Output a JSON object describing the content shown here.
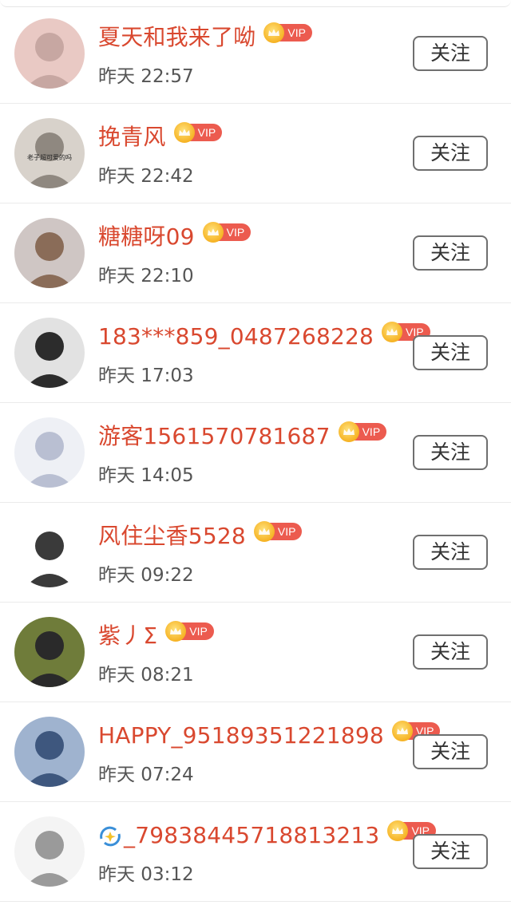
{
  "colors": {
    "name": "#d9482f",
    "vip_badge": "#ec5b4f",
    "crown": "#f6b324",
    "time": "#555555",
    "divider": "#ebebeb"
  },
  "vip_label": "VIP",
  "follow_label": "关注",
  "rows": [
    {
      "name": "夏天和我来了呦",
      "time": "昨天 22:57",
      "avatar": "avatar-girl-pink-hair",
      "avatar_colors": [
        "#e9c9c4",
        "#c7a7a2"
      ]
    },
    {
      "name": "挽青风",
      "time": "昨天 22:42",
      "avatar": "avatar-cat",
      "avatar_colors": [
        "#d8d2cb",
        "#8f8880"
      ],
      "avatar_caption": "老子超可爱的吗"
    },
    {
      "name": "糖糖呀09",
      "time": "昨天 22:10",
      "avatar": "avatar-teddy-bear",
      "avatar_colors": [
        "#cfc6c4",
        "#8a6c58"
      ]
    },
    {
      "name": "183***859_0487268228",
      "time": "昨天 17:03",
      "avatar": "avatar-boy-silver-hair",
      "avatar_colors": [
        "#e2e2e2",
        "#2c2c2c"
      ]
    },
    {
      "name": "游客1561570781687",
      "time": "昨天 14:05",
      "avatar": "avatar-anime-girl-flowers",
      "avatar_colors": [
        "#eef0f5",
        "#b9bfd2"
      ]
    },
    {
      "name": "风住尘香5528",
      "time": "昨天 09:22",
      "avatar": "avatar-cartoon-couple",
      "avatar_colors": [
        "#ffffff",
        "#3a3a3a"
      ]
    },
    {
      "name": "紫丿Σ",
      "time": "昨天 08:21",
      "avatar": "avatar-girl-glasses",
      "avatar_colors": [
        "#6f7c3a",
        "#2a2a2a"
      ]
    },
    {
      "name": "HAPPY_95189351221898",
      "time": "昨天 07:24",
      "avatar": "avatar-night-sky-figure",
      "avatar_colors": [
        "#9fb3cf",
        "#3e577e"
      ]
    },
    {
      "name": "_79838445718813213",
      "name_prefix_icon": "sparkle-swirl-icon",
      "time": "昨天 03:12",
      "avatar": "avatar-sketch-person",
      "avatar_colors": [
        "#f4f4f4",
        "#9a9a9a"
      ]
    }
  ]
}
